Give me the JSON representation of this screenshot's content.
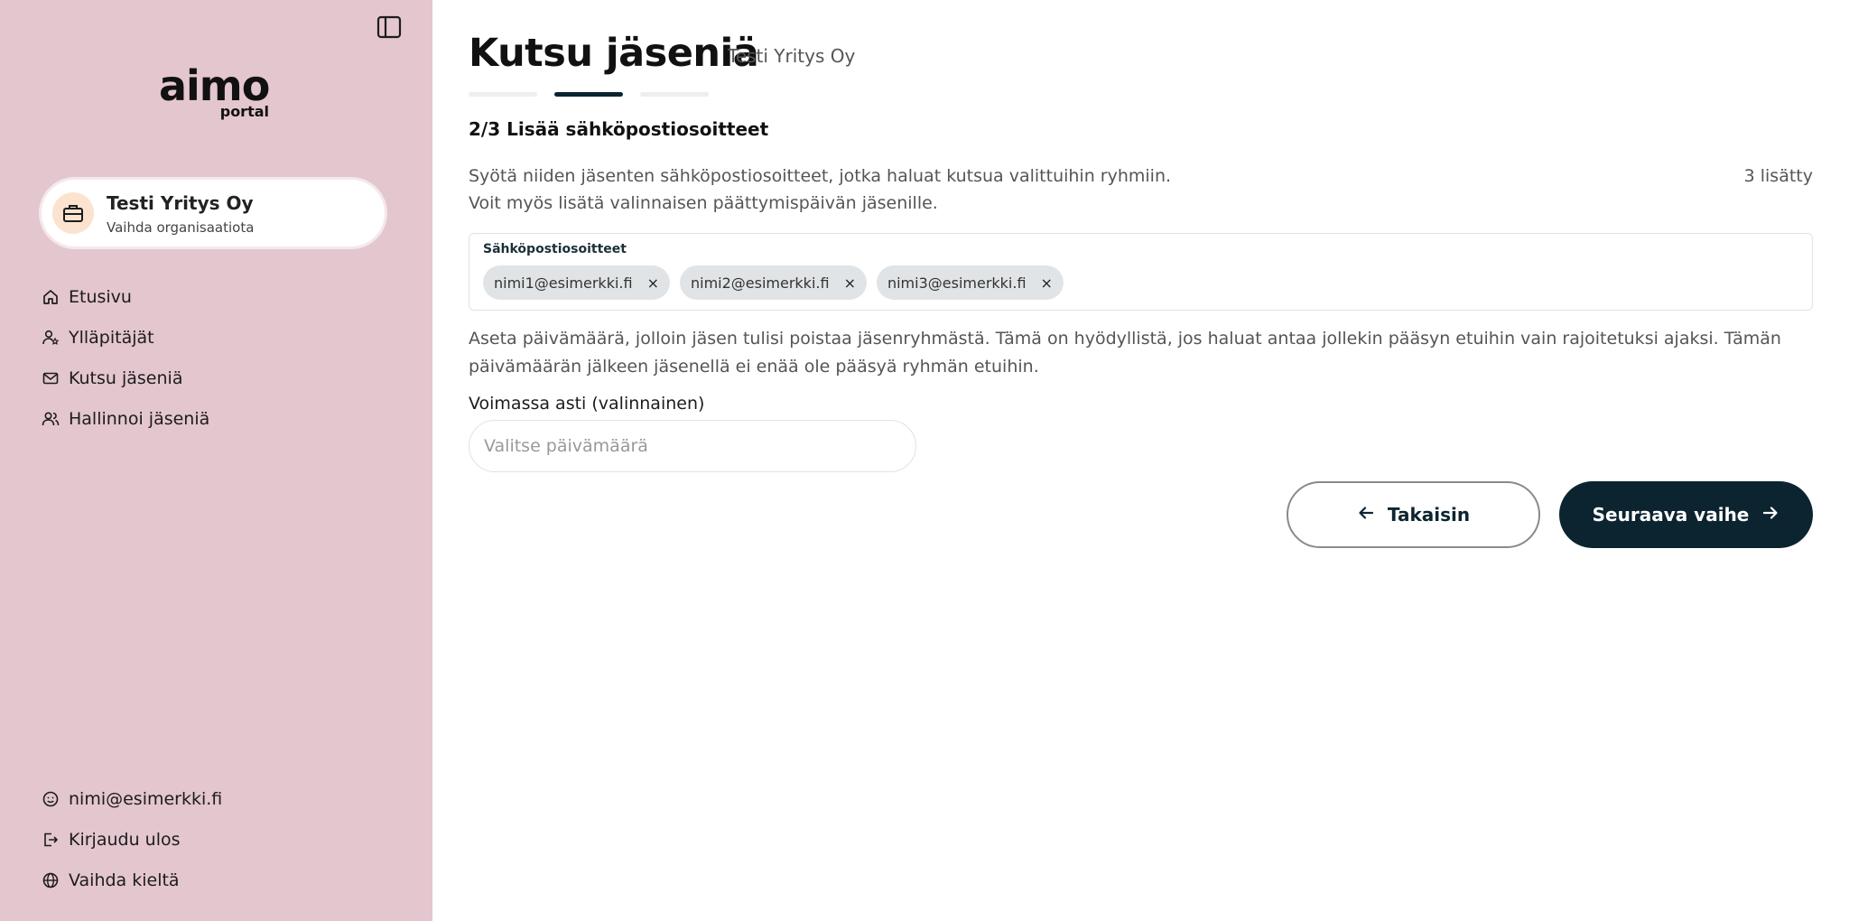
{
  "sidebar": {
    "logo": {
      "word": "aimo",
      "sub": "portal"
    },
    "org": {
      "name": "Testi Yritys Oy",
      "switch_label": "Vaihda organisaatiota"
    },
    "nav": [
      {
        "label": "Etusivu",
        "icon": "home-icon"
      },
      {
        "label": "Ylläpitäjät",
        "icon": "admin-user-icon"
      },
      {
        "label": "Kutsu jäseniä",
        "icon": "mail-icon"
      },
      {
        "label": "Hallinnoi jäseniä",
        "icon": "users-icon"
      }
    ],
    "bottom": [
      {
        "label": "nimi@esimerkki.fi",
        "icon": "smiley-icon"
      },
      {
        "label": "Kirjaudu ulos",
        "icon": "logout-icon"
      },
      {
        "label": "Vaihda kieltä",
        "icon": "globe-icon"
      }
    ]
  },
  "main": {
    "title": "Kutsu jäseniä",
    "org_name": "Testi Yritys Oy",
    "stepper": {
      "total": 3,
      "current": 2
    },
    "step_heading": "2/3 Lisää sähköpostiosoitteet",
    "description": [
      "Syötä niiden jäsenten sähköpostiosoitteet, jotka haluat kutsua valittuihin ryhmiin.",
      "Voit myös lisätä valinnaisen päättymispäivän jäsenille."
    ],
    "added_count": "3 lisätty",
    "email_field": {
      "label": "Sähköpostiosoitteet",
      "chips": [
        "nimi1@esimerkki.fi",
        "nimi2@esimerkki.fi",
        "nimi3@esimerkki.fi"
      ],
      "remove_glyph": "×"
    },
    "info_text": [
      "Aseta päivämäärä, jolloin jäsen tulisi poistaa jäsenryhmästä. Tämä on hyödyllistä, jos haluat antaa jollekin pääsyn etuihin vain rajoitetuksi ajaksi. Tämän",
      "päivämäärän jälkeen jäsenellä ei enää ole pääsyä ryhmän etuihin."
    ],
    "date_field": {
      "label": "Voimassa asti (valinnainen)",
      "placeholder": "Valitse päivämäärä",
      "value": ""
    },
    "buttons": {
      "back": "Takaisin",
      "next": "Seuraava vaihe"
    }
  },
  "colors": {
    "sidebar_bg": "#e4c6cf",
    "primary": "#0c2430",
    "chip_bg": "#e1e4e6",
    "avatar_bg": "#fbe3cf"
  }
}
